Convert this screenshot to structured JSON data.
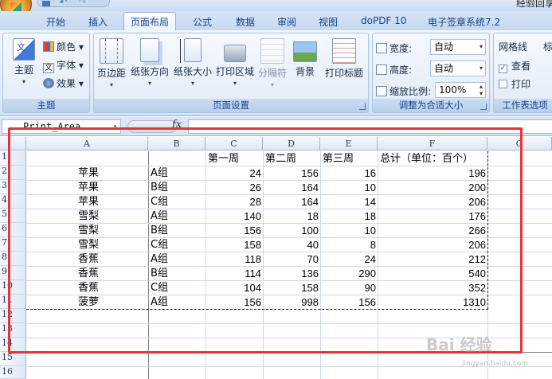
{
  "window": {
    "title": "经验回享"
  },
  "tabs": [
    {
      "label": "开始"
    },
    {
      "label": "插入"
    },
    {
      "label": "页面布局"
    },
    {
      "label": "公式"
    },
    {
      "label": "数据"
    },
    {
      "label": "审阅"
    },
    {
      "label": "视图"
    },
    {
      "label": "doPDF 10"
    },
    {
      "label": "电子签章系统7.2"
    }
  ],
  "active_tab": "页面布局",
  "ribbon": {
    "theme_group": {
      "label": "主题",
      "theme_button": "主题",
      "colors": "颜色",
      "fonts": "字体",
      "effects": "效果"
    },
    "page_setup_group": {
      "label": "页面设置",
      "margins": "页边距",
      "orientation": "纸张方向",
      "size": "纸张大小",
      "print_area": "打印区域",
      "breaks": "分隔符",
      "background": "背景",
      "print_titles": "打印标题"
    },
    "scale_group": {
      "label": "调整为合适大小",
      "width_label": "宽度:",
      "width_value": "自动",
      "height_label": "高度:",
      "height_value": "自动",
      "scale_label": "缩放比例:",
      "scale_value": "100%"
    },
    "sheet_options_group": {
      "label": "工作表选项",
      "gridlines": "网格线",
      "view": "查看",
      "print": "打印",
      "headings_partial": "标"
    }
  },
  "formula_bar": {
    "name_box": "Print_Area",
    "fx": "fx",
    "content": ""
  },
  "columns": [
    "A",
    "B",
    "C",
    "D",
    "E",
    "F",
    "G"
  ],
  "rows": [
    "1",
    "2",
    "3",
    "4",
    "5",
    "6",
    "7",
    "8",
    "9",
    "10",
    "11",
    "12",
    "13",
    "14",
    "15",
    "16"
  ],
  "sheet": {
    "header": {
      "c": "第一周",
      "d": "第二周",
      "e": "第三周",
      "f": "总计（单位：百个）"
    },
    "data": [
      {
        "a": "苹果",
        "b": "A组",
        "c": "24",
        "d": "156",
        "e": "16",
        "f": "196"
      },
      {
        "a": "苹果",
        "b": "B组",
        "c": "26",
        "d": "164",
        "e": "10",
        "f": "200"
      },
      {
        "a": "苹果",
        "b": "C组",
        "c": "28",
        "d": "164",
        "e": "14",
        "f": "206"
      },
      {
        "a": "雪梨",
        "b": "A组",
        "c": "140",
        "d": "18",
        "e": "18",
        "f": "176"
      },
      {
        "a": "雪梨",
        "b": "B组",
        "c": "156",
        "d": "100",
        "e": "10",
        "f": "266"
      },
      {
        "a": "雪梨",
        "b": "C组",
        "c": "158",
        "d": "40",
        "e": "8",
        "f": "206"
      },
      {
        "a": "香蕉",
        "b": "A组",
        "c": "118",
        "d": "70",
        "e": "24",
        "f": "212"
      },
      {
        "a": "香蕉",
        "b": "B组",
        "c": "114",
        "d": "136",
        "e": "290",
        "f": "540"
      },
      {
        "a": "香蕉",
        "b": "C组",
        "c": "104",
        "d": "158",
        "e": "90",
        "f": "352"
      },
      {
        "a": "菠萝",
        "b": "A组",
        "c": "156",
        "d": "998",
        "e": "156",
        "f": "1310"
      }
    ]
  },
  "watermark": {
    "text": "Bai 经验",
    "sub": "jingyan.baidu.com"
  },
  "colors": {
    "annotation_box": "#e4343b",
    "ribbon_text": "#15428b"
  }
}
